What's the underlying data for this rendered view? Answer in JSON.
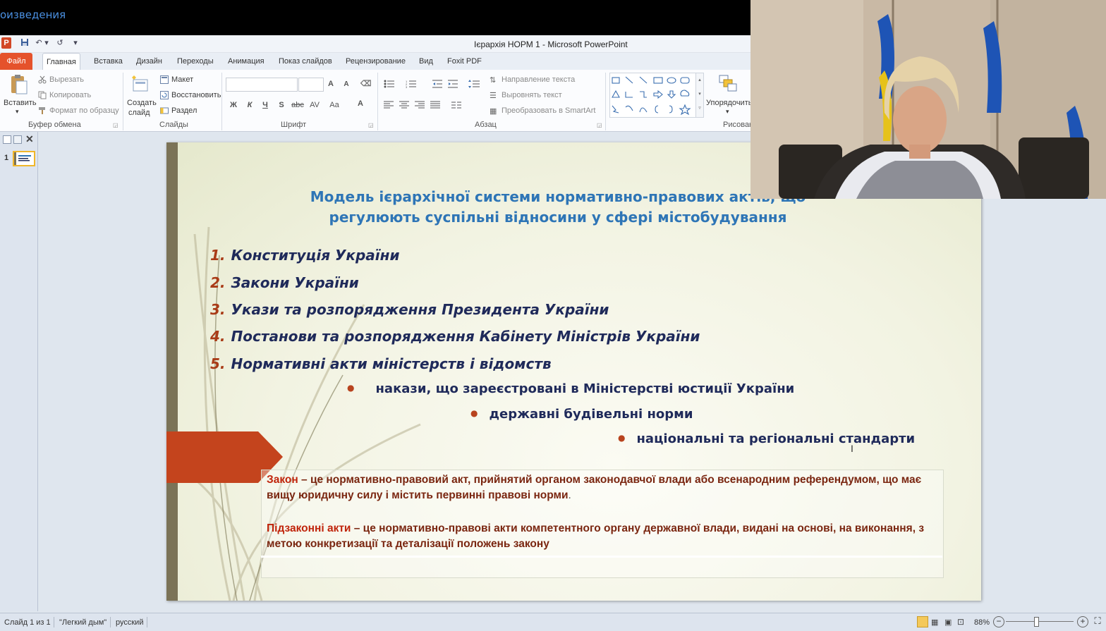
{
  "window": {
    "top_strip_title": "оизведения",
    "app_title": "Ієрархія НОРМ 1 -  Microsoft PowerPoint",
    "logo": "P"
  },
  "tabs": [
    "Файл",
    "Главная",
    "Вставка",
    "Дизайн",
    "Переходы",
    "Анимация",
    "Показ слайдов",
    "Рецензирование",
    "Вид",
    "Foxit PDF"
  ],
  "ribbon": {
    "clipboard": {
      "paste": "Вставить",
      "cut": "Вырезать",
      "copy": "Копировать",
      "format_painter": "Формат по образцу",
      "label": "Буфер обмена"
    },
    "slides": {
      "new_slide_1": "Создать",
      "new_slide_2": "слайд",
      "layout": "Макет",
      "reset": "Восстановить",
      "section": "Раздел",
      "label": "Слайды"
    },
    "font": {
      "label": "Шрифт",
      "buttons": [
        "Ж",
        "К",
        "Ч",
        "S",
        "abc",
        "AV",
        "Aa",
        "A"
      ]
    },
    "paragraph": {
      "text_direction": "Направление текста",
      "align_text": "Выровнять текст",
      "smartart": "Преобразовать в SmartArt",
      "label": "Абзац"
    },
    "drawing": {
      "arrange": "Упорядочить",
      "label": "Рисован"
    }
  },
  "thumbnails": {
    "slide_number": "1"
  },
  "slide": {
    "title": "Модель ієрархічної системи нормативно-правових актів, що регулюють суспільні відносини у сфері містобудування",
    "items": [
      {
        "num": "1.",
        "text": "Конституція України"
      },
      {
        "num": "2.",
        "text": "Закони України"
      },
      {
        "num": "3.",
        "text": "Укази та розпорядження  Президента України"
      },
      {
        "num": "4.",
        "text": "Постанови та розпорядження  Кабінету Міністрів України"
      },
      {
        "num": "5.",
        "text": "Нормативні акти міністерств і відомств"
      }
    ],
    "bullets": [
      "накази, що зареєстровані в Міністерстві юстиції України",
      "державні будівельні норми",
      "національні та регіональні стандарти"
    ],
    "definitions": {
      "law_term": "Закон",
      "law_text": " – це нормативно-правовий акт, прийнятий органом законодавчої влади або всенародним референдумом, що має вищу юридичну силу і містить первинні правові норми",
      "law_end": ".",
      "sub_term": "Підзаконні акти",
      "sub_text": " – це нормативно-правові акти компетентного органу державної влади, видані на основі, на виконання, з метою конкретизації та деталізації положень закону"
    }
  },
  "status": {
    "slide_info": "Слайд 1 из 1",
    "theme": "\"Легкий дым\"",
    "language": "русский",
    "zoom": "88%"
  },
  "colors": {
    "file_tab": "#e5522b",
    "title_blue": "#2e75b6",
    "item_navy": "#1f2a5a",
    "number_rust": "#a93b17",
    "definition_brown": "#7a2610",
    "term_red": "#c0240b",
    "slide_bar": "#7b7357",
    "arrow_shape": "#c4441d"
  }
}
